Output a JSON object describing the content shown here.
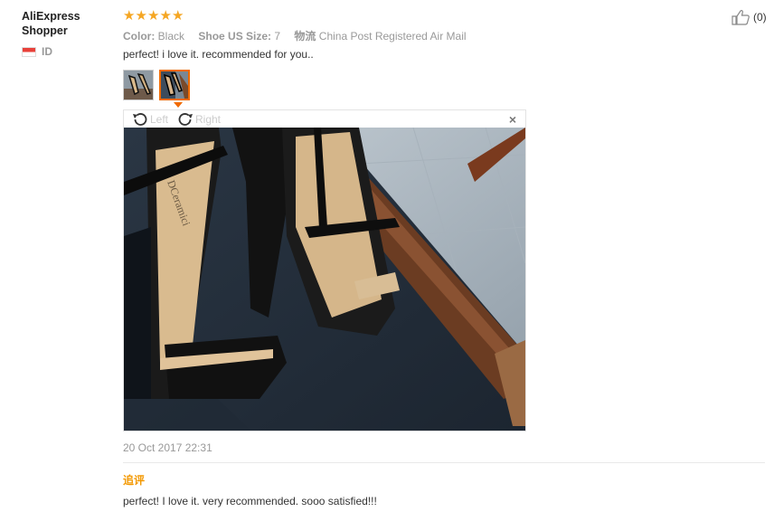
{
  "user": {
    "name": "AliExpress Shopper",
    "country_code": "ID"
  },
  "review": {
    "rating": 5,
    "star_count": 5,
    "attributes": [
      {
        "label": "Color:",
        "value": "Black"
      },
      {
        "label": "Shoe US Size:",
        "value": "7"
      },
      {
        "label": "物流",
        "value": "China Post Registered Air Mail"
      }
    ],
    "text": "perfect! i love it. recommended for you..",
    "likes": "(0)",
    "date": "20 Oct 2017 22:31"
  },
  "viewer": {
    "rotate_left": "Left",
    "rotate_right": "Right",
    "close": "×"
  },
  "followup": {
    "label": "追评",
    "text": "perfect! I love it. very recommended. sooo satisfied!!!"
  },
  "colors": {
    "star": "#f5a623",
    "accent": "#f06a00",
    "followup_label": "#f39800"
  }
}
